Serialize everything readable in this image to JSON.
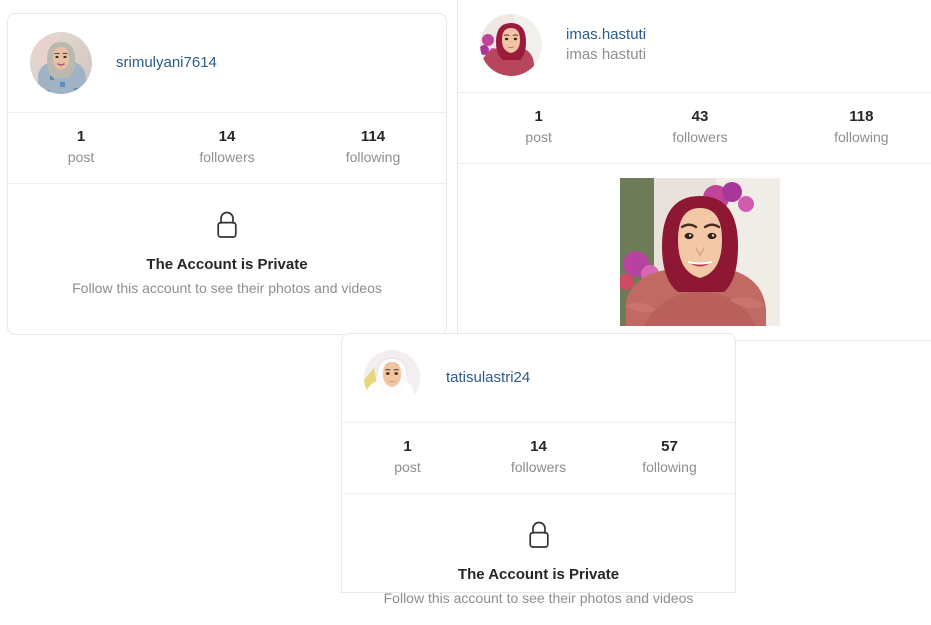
{
  "page": {
    "background_color": "#ffffff",
    "link_color": "#2b5c8a",
    "muted_text_color": "#8e8e8e",
    "primary_text_color": "#262626",
    "border_color": "#e8e8e8"
  },
  "private_notice": {
    "icon": "lock-icon",
    "title": "The Account is Private",
    "subtitle": "Follow this account to see their photos and videos"
  },
  "stat_labels": {
    "posts": "post",
    "followers": "followers",
    "following": "following"
  },
  "cards": [
    {
      "id": "card-1",
      "username": "srimulyani7614",
      "fullname": "",
      "avatar": "avatar-srimulyani7614",
      "stats": {
        "posts_value": "1",
        "posts_label": "post",
        "followers_value": "14",
        "followers_label": "followers",
        "following_value": "114",
        "following_label": "following"
      },
      "is_private": true,
      "private_title": "The Account is Private",
      "private_subtitle": "Follow this account to see their photos and videos",
      "posts": []
    },
    {
      "id": "card-2",
      "username": "imas.hastuti",
      "fullname": "imas hastuti",
      "avatar": "avatar-imas-hastuti",
      "stats": {
        "posts_value": "1",
        "posts_label": "post",
        "followers_value": "43",
        "followers_label": "followers",
        "following_value": "118",
        "following_label": "following"
      },
      "is_private": false,
      "posts": [
        {
          "thumbnail": "post-thumbnail-imas-hastuti-1"
        }
      ]
    },
    {
      "id": "card-3",
      "username": "tatisulastri24",
      "fullname": "",
      "avatar": "avatar-tatisulastri24",
      "stats": {
        "posts_value": "1",
        "posts_label": "post",
        "followers_value": "14",
        "followers_label": "followers",
        "following_value": "57",
        "following_label": "following"
      },
      "is_private": true,
      "private_title": "The Account is Private",
      "private_subtitle": "Follow this account to see their photos and videos",
      "posts": []
    }
  ]
}
